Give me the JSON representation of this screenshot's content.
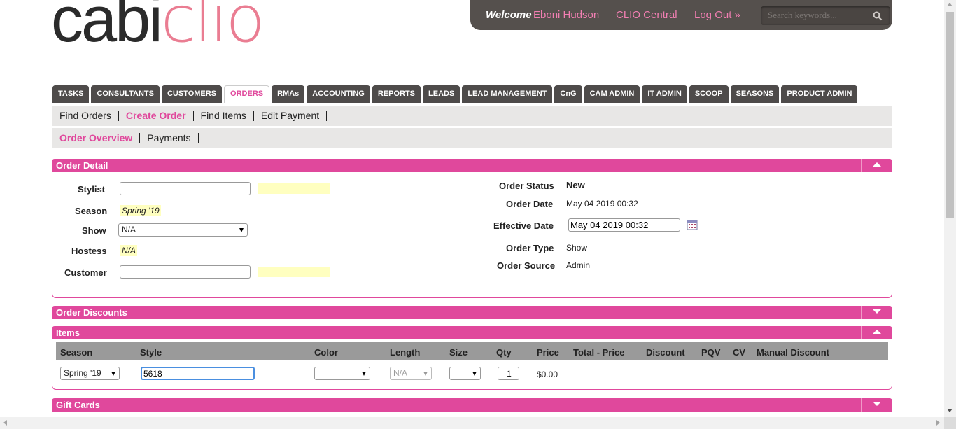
{
  "logo": {
    "part1": "cabi",
    "part2": "clio"
  },
  "userbar": {
    "welcome": "Welcome",
    "user_name": "Eboni Hudson",
    "clio_central": "CLIO Central",
    "logout": "Log Out »",
    "search_placeholder": "Search keywords..."
  },
  "main_nav": [
    "TASKS",
    "CONSULTANTS",
    "CUSTOMERS",
    "ORDERS",
    "RMAs",
    "ACCOUNTING",
    "REPORTS",
    "LEADS",
    "LEAD MANAGEMENT",
    "CnG",
    "CAM ADMIN",
    "IT ADMIN",
    "SCOOP",
    "SEASONS",
    "PRODUCT ADMIN"
  ],
  "main_nav_active": "ORDERS",
  "subnav1": [
    "Find Orders",
    "Create Order",
    "Find Items",
    "Edit Payment"
  ],
  "subnav1_active": "Create Order",
  "subnav2": [
    "Order Overview",
    "Payments"
  ],
  "subnav2_active": "Order Overview",
  "order_detail": {
    "title": "Order Detail",
    "stylist_label": "Stylist",
    "stylist_value": "",
    "season_label": "Season",
    "season_value": "Spring '19",
    "show_label": "Show",
    "show_value": "N/A",
    "hostess_label": "Hostess",
    "hostess_value": "N/A",
    "customer_label": "Customer",
    "customer_value": "",
    "status_label": "Order Status",
    "status_value": "New",
    "date_label": "Order Date",
    "date_value": "May 04 2019 00:32",
    "effective_label": "Effective Date",
    "effective_value": "May 04 2019 00:32",
    "type_label": "Order Type",
    "type_value": "Show",
    "source_label": "Order Source",
    "source_value": "Admin"
  },
  "order_discounts": {
    "title": "Order Discounts"
  },
  "items": {
    "title": "Items",
    "columns": [
      "Season",
      "Style",
      "Color",
      "Length",
      "Size",
      "Qty",
      "Price",
      "Total - Price",
      "Discount",
      "PQV",
      "CV",
      "Manual Discount"
    ],
    "row": {
      "season": "Spring '19",
      "style": "5618",
      "color": "",
      "length": "N/A",
      "size": "",
      "qty": "1",
      "price": "$0.00"
    }
  },
  "gift_cards": {
    "title": "Gift Cards"
  },
  "colors": {
    "accent": "#e0489c",
    "nav_bg": "#4e4b4a",
    "userbar_bg": "#55504d",
    "link_pink": "#f27fb3",
    "highlight": "#ffffc0"
  }
}
